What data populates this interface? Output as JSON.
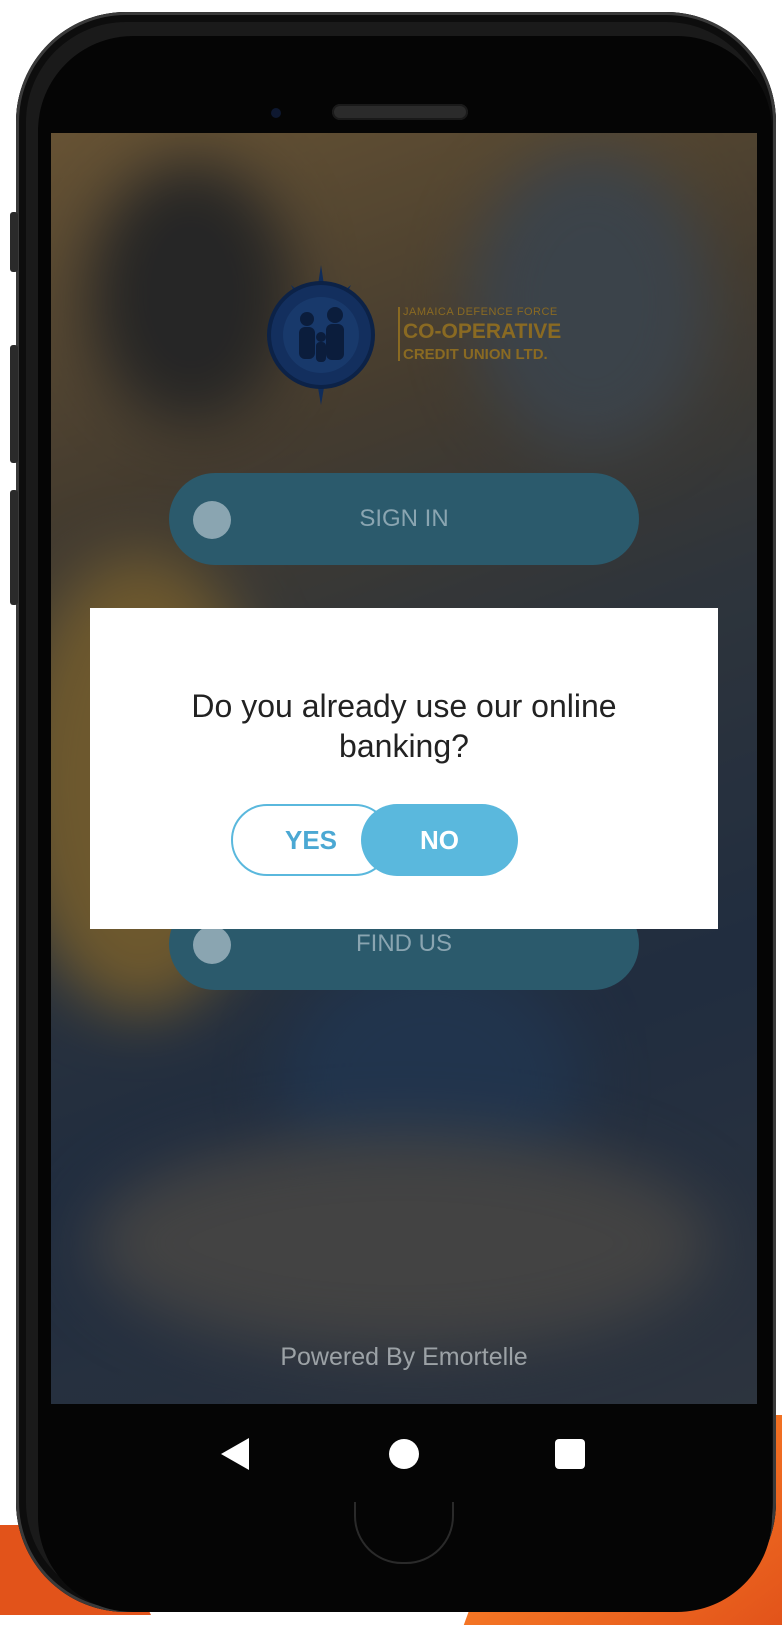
{
  "logo": {
    "line1": "JAMAICA DEFENCE FORCE",
    "line2": "CO-OPERATIVE",
    "line3": "CREDIT UNION LTD.",
    "seal_text": "JAMAICA DEFENCE FORCE CO-OPERATIVE CREDIT UNION LIMITED",
    "color": "#8a6a22"
  },
  "menu": {
    "sign_in": "SIGN IN",
    "find_us": "FIND US"
  },
  "dialog": {
    "question": "Do you already use our online banking?",
    "yes_label": "YES",
    "no_label": "NO",
    "accent_color": "#5ab8dd"
  },
  "footer": {
    "powered_by": "Powered By Emortelle"
  },
  "navbar": {
    "back_icon": "triangle-back",
    "home_icon": "circle-home",
    "recent_icon": "square-recents"
  }
}
